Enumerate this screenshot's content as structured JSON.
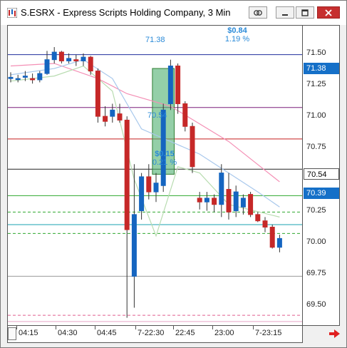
{
  "window": {
    "title": "S.ESRX - Express Scripts Holding Company, 3 Min",
    "buttons": {
      "link": "link-icon",
      "minimize": "minimize-icon",
      "maximize": "maximize-icon",
      "close": "close-icon"
    }
  },
  "price_axis": {
    "labels": [
      "71.50",
      "71.25",
      "71.00",
      "70.75",
      "70.25",
      "70.00",
      "69.75",
      "69.50"
    ],
    "tags": [
      {
        "text": "71.38",
        "bg": "#1570c8",
        "fg": "#ffffff"
      },
      {
        "text": "70.54",
        "bg": "#ffffff",
        "fg": "#000000"
      },
      {
        "text": "70.39",
        "bg": "#1570c8",
        "fg": "#ffffff"
      }
    ]
  },
  "time_axis": {
    "labels": [
      "04:15",
      "04:30",
      "04:45",
      "7-22:30",
      "22:45",
      "23:00",
      "7-23:15"
    ]
  },
  "annotations": {
    "measure_top_value": "$0.84",
    "measure_top_pct": "1.19 %",
    "measure_bottom_value": "$0.15",
    "measure_bottom_pct": "0.21 %",
    "measure_box_top_price": "71.38",
    "measure_box_bottom_price": "70.54"
  },
  "chart_data": {
    "type": "candlestick",
    "ylim": [
      69.33,
      71.72
    ],
    "candles": [
      {
        "o": 71.3,
        "h": 71.35,
        "l": 71.27,
        "c": 71.31
      },
      {
        "o": 71.3,
        "h": 71.33,
        "l": 71.27,
        "c": 71.3
      },
      {
        "o": 71.31,
        "h": 71.36,
        "l": 71.28,
        "c": 71.32
      },
      {
        "o": 71.3,
        "h": 71.34,
        "l": 71.26,
        "c": 71.29
      },
      {
        "o": 71.29,
        "h": 71.36,
        "l": 71.27,
        "c": 71.34
      },
      {
        "o": 71.34,
        "h": 71.52,
        "l": 71.33,
        "c": 71.45
      },
      {
        "o": 71.45,
        "h": 71.55,
        "l": 71.42,
        "c": 71.51
      },
      {
        "o": 71.51,
        "h": 71.52,
        "l": 71.42,
        "c": 71.44
      },
      {
        "o": 71.44,
        "h": 71.5,
        "l": 71.42,
        "c": 71.46
      },
      {
        "o": 71.45,
        "h": 71.49,
        "l": 71.4,
        "c": 71.44
      },
      {
        "o": 71.44,
        "h": 71.5,
        "l": 71.4,
        "c": 71.47
      },
      {
        "o": 71.47,
        "h": 71.48,
        "l": 71.33,
        "c": 71.36
      },
      {
        "o": 71.36,
        "h": 71.38,
        "l": 70.95,
        "c": 71.0
      },
      {
        "o": 71.0,
        "h": 71.08,
        "l": 70.92,
        "c": 70.96
      },
      {
        "o": 71.0,
        "h": 71.1,
        "l": 70.95,
        "c": 71.05
      },
      {
        "o": 71.02,
        "h": 71.1,
        "l": 70.95,
        "c": 70.97
      },
      {
        "o": 70.97,
        "h": 71.0,
        "l": 69.4,
        "c": 70.1
      },
      {
        "o": 69.73,
        "h": 70.62,
        "l": 69.48,
        "c": 70.22
      },
      {
        "o": 70.25,
        "h": 70.55,
        "l": 70.18,
        "c": 70.52
      },
      {
        "o": 70.52,
        "h": 70.62,
        "l": 70.34,
        "c": 70.4
      },
      {
        "o": 70.4,
        "h": 70.55,
        "l": 70.32,
        "c": 70.47
      },
      {
        "o": 70.45,
        "h": 71.1,
        "l": 70.4,
        "c": 71.05
      },
      {
        "o": 71.1,
        "h": 71.45,
        "l": 71.05,
        "c": 71.4
      },
      {
        "o": 71.4,
        "h": 71.42,
        "l": 71.02,
        "c": 71.1
      },
      {
        "o": 71.1,
        "h": 71.12,
        "l": 70.88,
        "c": 70.92
      },
      {
        "o": 70.92,
        "h": 70.95,
        "l": 70.55,
        "c": 70.6
      },
      {
        "o": 70.35,
        "h": 70.4,
        "l": 70.26,
        "c": 70.32
      },
      {
        "o": 70.32,
        "h": 70.4,
        "l": 70.25,
        "c": 70.35
      },
      {
        "o": 70.35,
        "h": 70.38,
        "l": 70.24,
        "c": 70.3
      },
      {
        "o": 70.3,
        "h": 70.62,
        "l": 70.2,
        "c": 70.55
      },
      {
        "o": 70.42,
        "h": 70.55,
        "l": 70.18,
        "c": 70.24
      },
      {
        "o": 70.25,
        "h": 70.45,
        "l": 70.2,
        "c": 70.4
      },
      {
        "o": 70.28,
        "h": 70.38,
        "l": 70.22,
        "c": 70.35
      },
      {
        "o": 70.38,
        "h": 70.4,
        "l": 70.2,
        "c": 70.22
      },
      {
        "o": 70.22,
        "h": 70.24,
        "l": 70.16,
        "c": 70.17
      },
      {
        "o": 70.17,
        "h": 70.2,
        "l": 70.08,
        "c": 70.12
      },
      {
        "o": 70.12,
        "h": 70.14,
        "l": 69.95,
        "c": 69.96
      },
      {
        "o": 69.96,
        "h": 70.06,
        "l": 69.92,
        "c": 70.03
      }
    ],
    "h_lines": [
      {
        "y": 71.49,
        "color": "#1f2d9c"
      },
      {
        "y": 71.07,
        "color": "#7a1e7a"
      },
      {
        "y": 70.82,
        "color": "#c81e1e"
      },
      {
        "y": 70.58,
        "color": "#222222"
      },
      {
        "y": 70.37,
        "color": "#2ea82e"
      },
      {
        "y": 70.24,
        "color": "#2ea82e",
        "dash": true
      },
      {
        "y": 70.14,
        "color": "#1aa0b0"
      },
      {
        "y": 70.07,
        "color": "#2ea82e",
        "dash": true
      },
      {
        "y": 69.73,
        "color": "#999999"
      },
      {
        "y": 69.42,
        "color": "#e05c8c",
        "dash": true
      },
      {
        "y": 69.37,
        "color": "#e8a8c8"
      }
    ],
    "ma_lines": [
      {
        "color": "#f48fb5",
        "points": [
          [
            0,
            71.4
          ],
          [
            6,
            71.42
          ],
          [
            12,
            71.3
          ],
          [
            16,
            71.18
          ],
          [
            22,
            71.08
          ],
          [
            30,
            70.8
          ],
          [
            37,
            70.48
          ]
        ]
      },
      {
        "color": "#a8c8ec",
        "points": [
          [
            0,
            71.33
          ],
          [
            6,
            71.38
          ],
          [
            10,
            71.45
          ],
          [
            14,
            71.3
          ],
          [
            18,
            70.9
          ],
          [
            22,
            70.8
          ],
          [
            26,
            70.7
          ],
          [
            30,
            70.55
          ],
          [
            34,
            70.4
          ],
          [
            37,
            70.28
          ]
        ]
      },
      {
        "color": "#b8dcb0",
        "points": [
          [
            0,
            71.28
          ],
          [
            6,
            71.32
          ],
          [
            10,
            71.4
          ],
          [
            14,
            71.2
          ],
          [
            17,
            70.5
          ],
          [
            20,
            70.05
          ],
          [
            23,
            70.6
          ],
          [
            26,
            70.55
          ],
          [
            30,
            70.3
          ],
          [
            37,
            70.2
          ]
        ]
      }
    ],
    "measure_box": {
      "from": 19.5,
      "to": 22.5,
      "top": 71.38,
      "bottom": 70.54
    }
  }
}
